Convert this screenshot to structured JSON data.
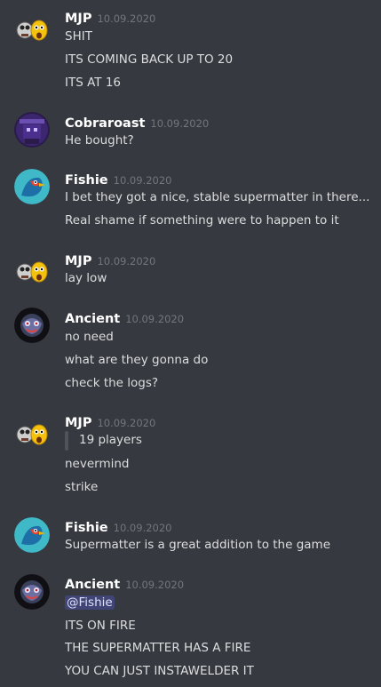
{
  "colors": {
    "background": "#36393f",
    "username": "#ffffff",
    "timestamp": "#72767d",
    "text": "#dcddde",
    "mention_bg": "#5865f24d",
    "mention_text": "#dee0fc"
  },
  "messages": [
    {
      "author": "MJP",
      "timestamp": "10.09.2020",
      "avatar_icon": "two-emoji-faces-icon",
      "lines": [
        "SHIT",
        "ITS COMING BACK UP TO 20",
        "ITS AT 16"
      ]
    },
    {
      "author": "Cobraroast",
      "timestamp": "10.09.2020",
      "avatar_icon": "purple-figure-avatar-icon",
      "lines": [
        "He bought?"
      ]
    },
    {
      "author": "Fishie",
      "timestamp": "10.09.2020",
      "avatar_icon": "bird-avatar-icon",
      "lines": [
        "I bet they got a nice, stable supermatter in there...",
        "Real shame if something were to happen to it"
      ]
    },
    {
      "author": "MJP",
      "timestamp": "10.09.2020",
      "avatar_icon": "two-emoji-faces-icon",
      "lines": [
        "lay low"
      ]
    },
    {
      "author": "Ancient",
      "timestamp": "10.09.2020",
      "avatar_icon": "dark-creature-avatar-icon",
      "lines": [
        "no need",
        "what are they gonna do",
        "check the logs?"
      ]
    },
    {
      "author": "MJP",
      "timestamp": "10.09.2020",
      "avatar_icon": "two-emoji-faces-icon",
      "quote": "19 players",
      "lines": [
        "nevermind",
        "strike"
      ]
    },
    {
      "author": "Fishie",
      "timestamp": "10.09.2020",
      "avatar_icon": "bird-avatar-icon",
      "lines": [
        "Supermatter is a great addition to the game"
      ]
    },
    {
      "author": "Ancient",
      "timestamp": "10.09.2020",
      "avatar_icon": "dark-creature-avatar-icon",
      "mention": "@Fishie",
      "lines": [
        "ITS ON FIRE",
        "THE SUPERMATTER HAS A FIRE",
        "YOU CAN JUST INSTAWELDER IT"
      ]
    }
  ]
}
